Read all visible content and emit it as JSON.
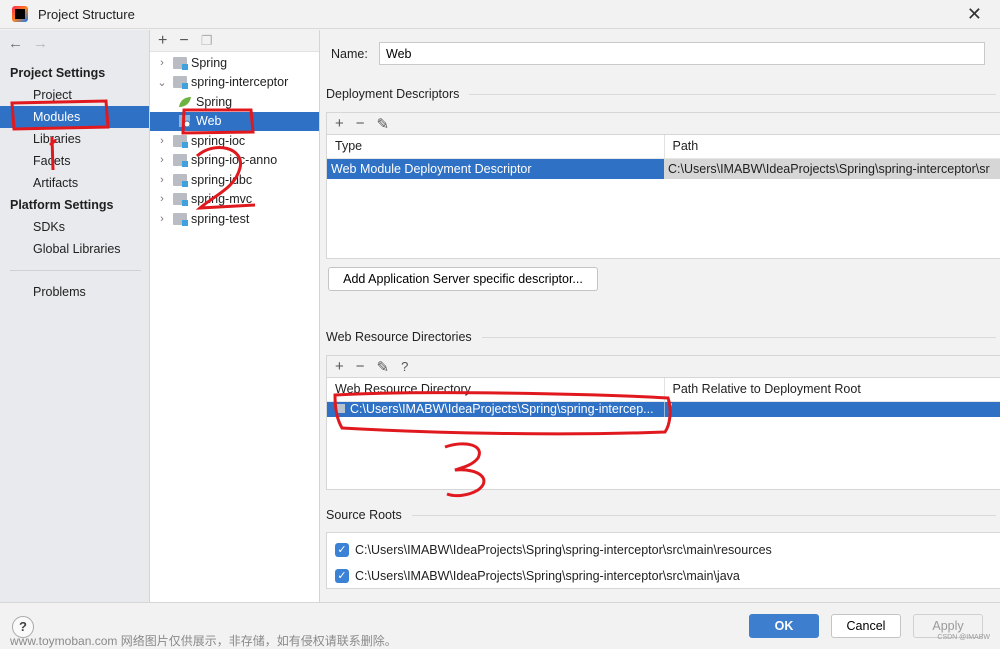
{
  "window": {
    "title": "Project Structure",
    "close_icon": "close-icon"
  },
  "nav": {
    "back_icon": "←",
    "forward_icon": "→",
    "project_settings_header": "Project Settings",
    "project_settings_items": [
      "Project",
      "Modules",
      "Libraries",
      "Facets",
      "Artifacts"
    ],
    "platform_settings_header": "Platform Settings",
    "platform_settings_items": [
      "SDKs",
      "Global Libraries"
    ],
    "problems": "Problems",
    "selected": "Modules"
  },
  "tree": {
    "toolbar": {
      "add": "+",
      "remove": "−",
      "copy": "copy-icon"
    },
    "items": [
      {
        "label": "Spring",
        "level": 0,
        "expanded": false,
        "icon": "module-folder-icon"
      },
      {
        "label": "spring-interceptor",
        "level": 0,
        "expanded": true,
        "icon": "module-folder-icon"
      },
      {
        "label": "Spring",
        "level": 1,
        "icon": "spring-leaf-icon"
      },
      {
        "label": "Web",
        "level": 1,
        "icon": "web-facet-icon",
        "selected": true
      },
      {
        "label": "spring-ioc",
        "level": 0,
        "expanded": false,
        "icon": "module-folder-icon"
      },
      {
        "label": "spring-ioc-anno",
        "level": 0,
        "expanded": false,
        "icon": "module-folder-icon"
      },
      {
        "label": "spring-jdbc",
        "level": 0,
        "expanded": false,
        "icon": "module-folder-icon"
      },
      {
        "label": "spring-mvc",
        "level": 0,
        "expanded": false,
        "icon": "module-folder-icon"
      },
      {
        "label": "spring-test",
        "level": 0,
        "expanded": false,
        "icon": "module-folder-icon"
      }
    ]
  },
  "main": {
    "name_label": "Name:",
    "name_value": "Web",
    "deployment": {
      "title": "Deployment Descriptors",
      "columns": [
        "Type",
        "Path"
      ],
      "rows": [
        {
          "type": "Web Module Deployment Descriptor",
          "path": "C:\\Users\\IMABW\\IdeaProjects\\Spring\\spring-interceptor\\sr"
        }
      ],
      "add_server_button": "Add Application Server specific descriptor..."
    },
    "web_resources": {
      "title": "Web Resource Directories",
      "help": "?",
      "columns": [
        "Web Resource Directory",
        "Path Relative to Deployment Root"
      ],
      "rows": [
        {
          "dir": "C:\\Users\\IMABW\\IdeaProjects\\Spring\\spring-intercep...",
          "rel": "/"
        }
      ]
    },
    "source_roots": {
      "title": "Source Roots",
      "items": [
        {
          "path": "C:\\Users\\IMABW\\IdeaProjects\\Spring\\spring-interceptor\\src\\main\\resources",
          "checked": true
        },
        {
          "path": "C:\\Users\\IMABW\\IdeaProjects\\Spring\\spring-interceptor\\src\\main\\java",
          "checked": true
        }
      ]
    }
  },
  "footer": {
    "help": "?",
    "ok": "OK",
    "cancel": "Cancel",
    "apply": "Apply",
    "watermark": "www.toymoban.com 网络图片仅供展示，非存储，如有侵权请联系删除。",
    "csdn": "CSDN @IMABW"
  },
  "annotations": [
    "1",
    "2",
    "3"
  ],
  "colors": {
    "selection": "#2f71c4",
    "annotation": "#e0191f",
    "checkbox": "#3b82d6",
    "ok_button": "#3d7fce"
  }
}
